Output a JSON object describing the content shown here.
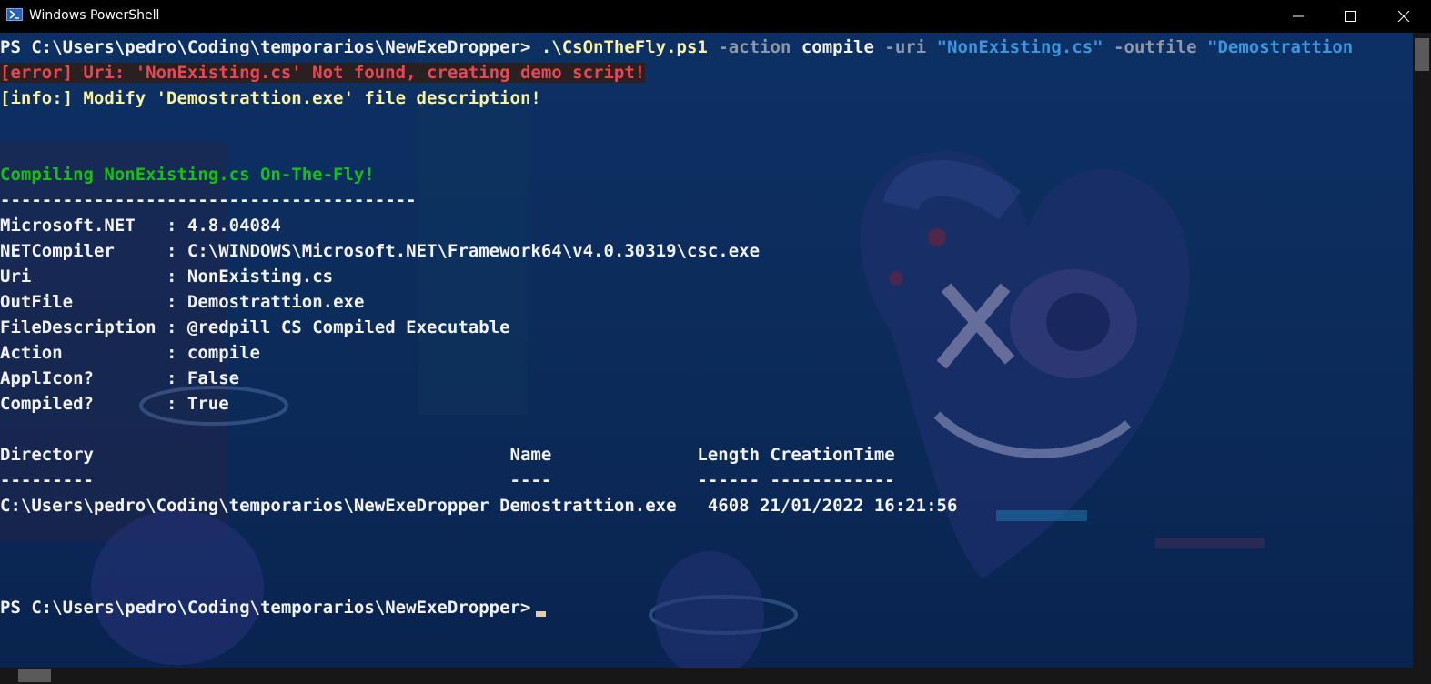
{
  "window": {
    "title": "Windows PowerShell",
    "icon": "powershell-icon",
    "controls": [
      "minimize-icon",
      "maximize-icon",
      "close-icon"
    ]
  },
  "colors": {
    "prompt": "#f2f2f2",
    "parameter": "#8e98a8",
    "string": "#3a96dd",
    "error": "#e74856",
    "info": "#f9f1a5",
    "success": "#13c113"
  },
  "terminal": {
    "command": {
      "prompt": "PS C:\\Users\\pedro\\Coding\\temporarios\\NewExeDropper> ",
      "script": ".\\CsOnTheFly.ps1",
      "p1": "-action",
      "v1": "compile",
      "p2": "-uri",
      "v2": "\"NonExisting.cs\"",
      "p3": "-outfile",
      "v3": "\"Demostrattion"
    },
    "error_line": "[error] Uri: 'NonExisting.cs' Not found, creating demo script!",
    "info_line": "[info:] Modify 'Demostrattion.exe' file description!",
    "compiling_line": "Compiling NonExisting.cs On-The-Fly!",
    "separator": "----------------------------------------",
    "properties": [
      {
        "key": "Microsoft.NET   ",
        "value": "4.8.04084"
      },
      {
        "key": "NETCompiler     ",
        "value": "C:\\WINDOWS\\Microsoft.NET\\Framework64\\v4.0.30319\\csc.exe"
      },
      {
        "key": "Uri             ",
        "value": "NonExisting.cs"
      },
      {
        "key": "OutFile         ",
        "value": "Demostrattion.exe"
      },
      {
        "key": "FileDescription ",
        "value": "@redpill CS Compiled Executable"
      },
      {
        "key": "Action          ",
        "value": "compile"
      },
      {
        "key": "ApplIcon?       ",
        "value": "False"
      },
      {
        "key": "Compiled?       ",
        "value": "True"
      }
    ],
    "table": {
      "header": "Directory                                        Name              Length CreationTime",
      "underline": "---------                                        ----              ------ ------------",
      "row": "C:\\Users\\pedro\\Coding\\temporarios\\NewExeDropper Demostrattion.exe   4608 21/01/2022 16:21:56"
    },
    "final_prompt": "PS C:\\Users\\pedro\\Coding\\temporarios\\NewExeDropper>"
  }
}
